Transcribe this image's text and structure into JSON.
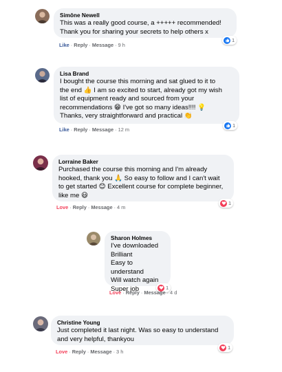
{
  "comments": [
    {
      "author": "Simône Newell",
      "lines": [
        "This was a really good course, a +++++ recommended!",
        "Thank you for sharing your secrets to help others x"
      ],
      "reaction_label": "Like",
      "reply_label": "Reply",
      "message_label": "Message",
      "time": "9 h",
      "reaction_icon": "like-icon",
      "reaction_count": "1"
    },
    {
      "author": "Lisa Brand",
      "lines": [
        "I bought the course this morning and sat glued to it to",
        "the end 👍 I am so excited to start, already got my wish",
        "list of equipment ready and sourced from your",
        "recommendations 😁 I've got so many ideas!!!! 💡",
        "Thanks, very straightforward and practical 👏"
      ],
      "reaction_label": "Like",
      "reply_label": "Reply",
      "message_label": "Message",
      "time": "12 m",
      "reaction_icon": "like-icon",
      "reaction_count": "1"
    },
    {
      "author": "Lorraine Baker",
      "lines": [
        "Purchased the course this morning and I'm already",
        "hooked, thank you 🙏 So easy to follow and I can't wait",
        "to get started 😊 Excellent course for complete beginner,",
        "like me 😃"
      ],
      "reaction_label": "Love",
      "reply_label": "Reply",
      "message_label": "Message",
      "time": "4 m",
      "reaction_icon": "heart-icon",
      "reaction_count": "1"
    },
    {
      "author": "Sharon Holmes",
      "lines": [
        "I've downloaded",
        "Brilliant",
        "Easy to understand",
        "Will watch again",
        "Super job"
      ],
      "reaction_label": "Love",
      "reply_label": "Reply",
      "message_label": "Message",
      "time": "4 d",
      "reaction_icon": "heart-icon",
      "reaction_count": "1"
    },
    {
      "author": "Christine Young",
      "lines": [
        "Just completed it last night. Was so easy to understand",
        "and very helpful, thankyou"
      ],
      "reaction_label": "Love",
      "reply_label": "Reply",
      "message_label": "Message",
      "time": "3 h",
      "reaction_icon": "heart-icon",
      "reaction_count": "1"
    }
  ],
  "colors": {
    "bubble": "#f0f2f5",
    "like": "#385898",
    "love": "#f33e58",
    "meta": "#65676b",
    "like_badge": "#1877f2"
  }
}
